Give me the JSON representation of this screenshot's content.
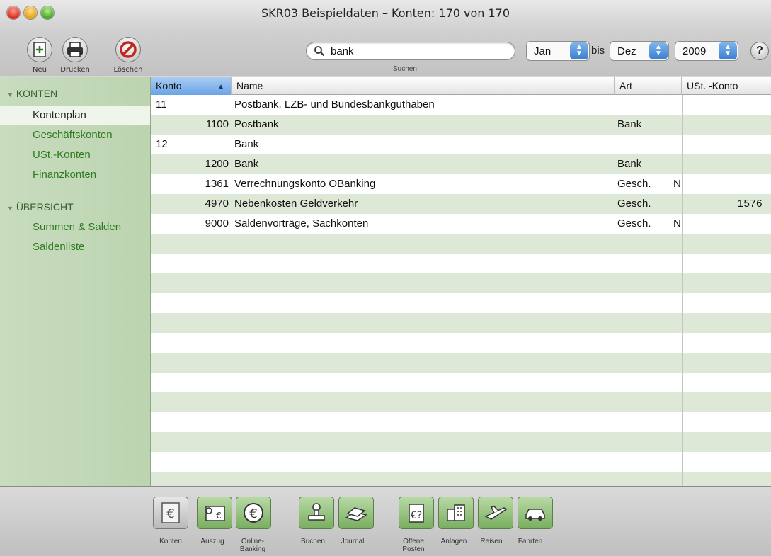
{
  "window": {
    "title": "SKR03 Beispieldaten – Konten: 170 von 170"
  },
  "toolbar": {
    "new_label": "Neu",
    "print_label": "Drucken",
    "delete_label": "Löschen",
    "search_value": "bank",
    "search_label": "Suchen",
    "from_month": "Jan",
    "bis_label": "bis",
    "to_month": "Dez",
    "year": "2009",
    "help_label": "?"
  },
  "sidebar": {
    "section1": "KONTEN",
    "items1": [
      "Kontenplan",
      "Geschäftskonten",
      "USt.-Konten",
      "Finanzkonten"
    ],
    "section2": "ÜBERSICHT",
    "items2": [
      "Summen & Salden",
      "Saldenliste"
    ],
    "selected": "Kontenplan"
  },
  "table": {
    "columns": [
      "Konto",
      "Name",
      "Art",
      "USt. -Konto"
    ],
    "rows": [
      {
        "konto": "11",
        "name": "Postbank, LZB- und Bundesbankguthaben",
        "art": "",
        "n": "",
        "ust": ""
      },
      {
        "konto": "1100",
        "name": "Postbank",
        "art": "Bank",
        "n": "",
        "ust": ""
      },
      {
        "konto": "12",
        "name": "Bank",
        "art": "",
        "n": "",
        "ust": ""
      },
      {
        "konto": "1200",
        "name": "Bank",
        "art": "Bank",
        "n": "",
        "ust": ""
      },
      {
        "konto": "1361",
        "name": "Verrechnungskonto OBanking",
        "art": "Gesch.",
        "n": "N",
        "ust": ""
      },
      {
        "konto": "4970",
        "name": "Nebenkosten Geldverkehr",
        "art": "Gesch.",
        "n": "",
        "ust": "1576"
      },
      {
        "konto": "9000",
        "name": "Saldenvorträge, Sachkonten",
        "art": "Gesch.",
        "n": "N",
        "ust": ""
      }
    ]
  },
  "dock": {
    "items": [
      "Konten",
      "Auszug",
      "Online-\nBanking",
      "Buchen",
      "Journal",
      "Offene\nPosten",
      "Anlagen",
      "Reisen",
      "Fahrten"
    ]
  },
  "colors": {
    "sidebar_green": "#c4d9b9",
    "row_stripe": "#dde8d7",
    "header_selected_blue": "#6aa4e6",
    "sidebar_item_text": "#2f7b22"
  }
}
